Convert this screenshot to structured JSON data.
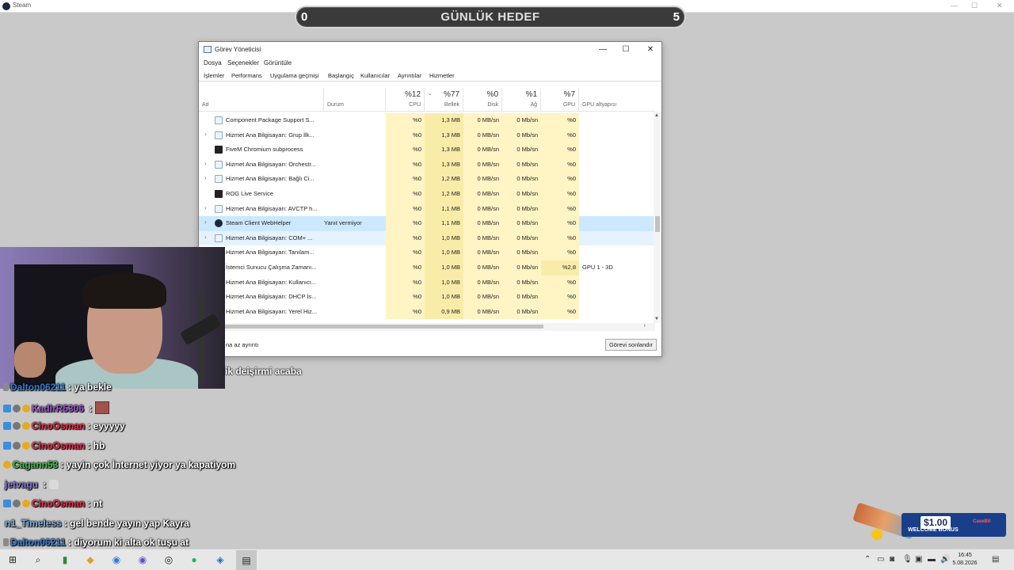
{
  "steam": {
    "title": "Steam"
  },
  "goal": {
    "left": "0",
    "label": "GÜNLÜK HEDEF",
    "right": "5"
  },
  "taskmanager": {
    "title": "Görev Yöneticisi",
    "menu": [
      "Dosya",
      "Seçenekler",
      "Görüntüle"
    ],
    "tabs": [
      "İşlemler",
      "Performans",
      "Uygulama geçmişi",
      "Başlangıç",
      "Kullanıcılar",
      "Ayrıntılar",
      "Hizmetler"
    ],
    "headers": {
      "name": "Ad",
      "status": "Durum",
      "cpu": {
        "pct": "%12",
        "label": "CPU"
      },
      "mem": {
        "pct": "%77",
        "label": "Bellek"
      },
      "disk": {
        "pct": "%0",
        "label": "Disk"
      },
      "net": {
        "pct": "%1",
        "label": "Ağ"
      },
      "gpu": {
        "pct": "%7",
        "label": "GPU"
      },
      "gpu_engine": "GPU altyapısı"
    },
    "rows": [
      {
        "name": "Component Package Support S...",
        "status": "",
        "cpu": "%0",
        "mem": "1,3 MB",
        "disk": "0 MB/sn",
        "net": "0 Mb/sn",
        "gpu": "%0",
        "engine": ""
      },
      {
        "name": "Hizmet Ana Bilgisayarı: Grup İlk...",
        "status": "",
        "cpu": "%0",
        "mem": "1,3 MB",
        "disk": "0 MB/sn",
        "net": "0 Mb/sn",
        "gpu": "%0",
        "engine": ""
      },
      {
        "name": "FiveM Chromium subprocess",
        "status": "",
        "cpu": "%0",
        "mem": "1,3 MB",
        "disk": "0 MB/sn",
        "net": "0 Mb/sn",
        "gpu": "%0",
        "engine": ""
      },
      {
        "name": "Hizmet Ana Bilgisayarı: Orchestr...",
        "status": "",
        "cpu": "%0",
        "mem": "1,3 MB",
        "disk": "0 MB/sn",
        "net": "0 Mb/sn",
        "gpu": "%0",
        "engine": ""
      },
      {
        "name": "Hizmet Ana Bilgisayarı: Bağlı Ci...",
        "status": "",
        "cpu": "%0",
        "mem": "1,2 MB",
        "disk": "0 MB/sn",
        "net": "0 Mb/sn",
        "gpu": "%0",
        "engine": ""
      },
      {
        "name": "ROG Live Service",
        "status": "",
        "cpu": "%0",
        "mem": "1,2 MB",
        "disk": "0 MB/sn",
        "net": "0 Mb/sn",
        "gpu": "%0",
        "engine": ""
      },
      {
        "name": "Hizmet Ana Bilgisayarı: AVCTP h...",
        "status": "",
        "cpu": "%0",
        "mem": "1,1 MB",
        "disk": "0 MB/sn",
        "net": "0 Mb/sn",
        "gpu": "%0",
        "engine": ""
      },
      {
        "name": "Steam Client WebHelper",
        "status": "Yanıt vermiyor",
        "cpu": "%0",
        "mem": "1,1 MB",
        "disk": "0 MB/sn",
        "net": "0 Mb/sn",
        "gpu": "%0",
        "engine": ""
      },
      {
        "name": "Hizmet Ana Bilgisayarı: COM+ ...",
        "status": "",
        "cpu": "%0",
        "mem": "1,0 MB",
        "disk": "0 MB/sn",
        "net": "0 Mb/sn",
        "gpu": "%0",
        "engine": ""
      },
      {
        "name": "Hizmet Ana Bilgisayarı: Tanılam...",
        "status": "",
        "cpu": "%0",
        "mem": "1,0 MB",
        "disk": "0 MB/sn",
        "net": "0 Mb/sn",
        "gpu": "%0",
        "engine": ""
      },
      {
        "name": "İstemci Sunucu Çalışma Zamanı...",
        "status": "",
        "cpu": "%0",
        "mem": "1,0 MB",
        "disk": "0 MB/sn",
        "net": "0 Mb/sn",
        "gpu": "%2,8",
        "engine": "GPU 1 - 3D"
      },
      {
        "name": "Hizmet Ana Bilgisayarı: Kullanıcı...",
        "status": "",
        "cpu": "%0",
        "mem": "1,0 MB",
        "disk": "0 MB/sn",
        "net": "0 Mb/sn",
        "gpu": "%0",
        "engine": ""
      },
      {
        "name": "Hizmet Ana Bilgisayarı: DHCP İs...",
        "status": "",
        "cpu": "%0",
        "mem": "1,0 MB",
        "disk": "0 MB/sn",
        "net": "0 Mb/sn",
        "gpu": "%0",
        "engine": ""
      },
      {
        "name": "Hizmet Ana Bilgisayarı: Yerel Hiz...",
        "status": "",
        "cpu": "%0",
        "mem": "0,9 MB",
        "disk": "0 MB/sn",
        "net": "0 Mb/sn",
        "gpu": "%0",
        "engine": ""
      }
    ],
    "less_details": "na az ayrıntı",
    "end_task": "Görevi sonlandır"
  },
  "chat": {
    "partial": "ik deişirmi acaba",
    "messages": [
      {
        "user": "Dalton06211",
        "color": "#3a7fd5",
        "text": ": ya bekle",
        "badges": [
          "pen"
        ]
      },
      {
        "user": "KadirR5306",
        "color": "#9b59d0",
        "text": " : ",
        "badges": [
          "blue",
          "gray",
          "gold"
        ],
        "emote": true
      },
      {
        "user": "CinoOsman",
        "color": "#e0304a",
        "text": ": eyyyyy",
        "badges": [
          "blue",
          "gray",
          "gold"
        ]
      },
      {
        "user": "CinoOsman",
        "color": "#e0304a",
        "text": ": hb",
        "badges": [
          "blue",
          "gray",
          "gold"
        ]
      },
      {
        "user": "Cagann53",
        "color": "#3fbf4a",
        "text": ": yayin çok İnternet yiyor ya kapatiyom",
        "badges": [
          "gold"
        ]
      },
      {
        "user": "jetvagu",
        "color": "#8a7ad8",
        "text": " : ",
        "badges": [],
        "emote2": true
      },
      {
        "user": "CinoOsman",
        "color": "#e0304a",
        "text": ": nt",
        "badges": [
          "blue",
          "gray",
          "gold"
        ]
      },
      {
        "user": "n1_Timeless",
        "color": "#7fb0e0",
        "text": ": gel bende yayın yap Kayra",
        "badges": []
      },
      {
        "user": "Dalton06211",
        "color": "#3a7fd5",
        "text": ": diyorum ki alta ok tuşu at",
        "badges": [
          "pen"
        ]
      }
    ]
  },
  "promo": {
    "amount": "$1.00",
    "label": "WELCOME BONUS",
    "brand": "CaseBit"
  },
  "taskbar": {
    "time": "16:45",
    "date": "5.08.2026"
  }
}
